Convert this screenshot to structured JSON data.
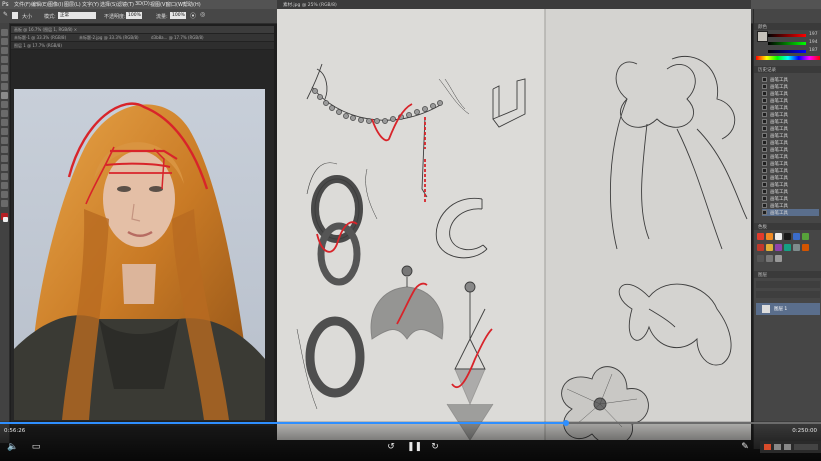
{
  "menubar": {
    "items": [
      "文件(F)",
      "编辑(E)",
      "图像(I)",
      "图层(L)",
      "文字(Y)",
      "选择(S)",
      "滤镜(T)",
      "3D(D)",
      "视图(V)",
      "窗口(W)",
      "帮助(H)"
    ]
  },
  "options_bar": {
    "size_label": "大小",
    "mode_label": "模式:",
    "mode_value": "正常",
    "opacity_label": "不透明度:",
    "opacity_value": "100%",
    "flow_label": "流量:",
    "flow_value": "100%",
    "workspace_label": "基本功能"
  },
  "left_document": {
    "tab1": "画板 @ 16.7% (图层 1, RGB/8) ×",
    "tab2_items": [
      "未标题-1 @ 33.3% (RGB/8)",
      "未标题-2.jpg @ 33.3% (RGB/8)",
      "d3b8a... @ 17.7% (RGB/8)"
    ],
    "sub_tab": "图层 1 @ 17.7% (RGB/8)"
  },
  "right_document": {
    "tab": "素材.jpg @ 25% (RGB/8)"
  },
  "panels": {
    "color_title": "颜色",
    "color_values": [
      "197",
      "194",
      "187"
    ],
    "history_title": "历史记录",
    "history_item_label": "画笔工具",
    "history_count": 20,
    "swatches_title": "色板",
    "layers_title": "图层",
    "layer_name": "图层 1"
  },
  "video": {
    "current_time": "0:56:26",
    "total_time": "0:250:00",
    "progress": 0.69
  },
  "colors": {
    "accent": "#2f8fff",
    "sketch_paper": "#dcdbd8",
    "annotation_red": "#d8242a"
  }
}
